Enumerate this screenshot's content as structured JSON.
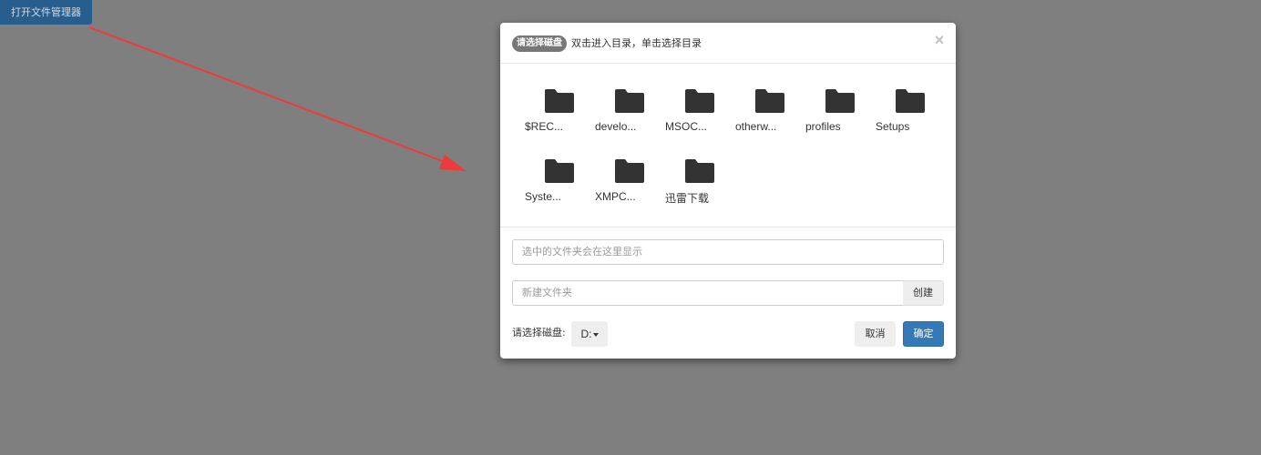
{
  "open_button": {
    "label": "打开文件管理器"
  },
  "modal": {
    "disk_badge": "请选择磁盘",
    "hint": "双击进入目录，单击选择目录",
    "close_symbol": "×",
    "folders": [
      {
        "label": "$REC...",
        "icon": "folder-icon"
      },
      {
        "label": "develo...",
        "icon": "folder-icon"
      },
      {
        "label": "MSOC...",
        "icon": "folder-icon"
      },
      {
        "label": "otherw...",
        "icon": "folder-icon"
      },
      {
        "label": "profiles",
        "icon": "folder-icon"
      },
      {
        "label": "Setups",
        "icon": "folder-icon"
      },
      {
        "label": "Syste...",
        "icon": "folder-icon"
      },
      {
        "label": "XMPC...",
        "icon": "folder-icon"
      },
      {
        "label": "迅雷下载",
        "icon": "folder-icon"
      }
    ],
    "selected_placeholder": "选中的文件夹会在这里显示",
    "new_folder_placeholder": "新建文件夹",
    "create_label": "创建",
    "disk_label": "请选择磁盘:",
    "disk_value": "D:",
    "cancel_label": "取消",
    "ok_label": "确定"
  },
  "colors": {
    "backdrop": "#7f7f7f",
    "open_button": "#285e8e",
    "primary": "#337ab7",
    "arrow": "#ee3a3a",
    "folder": "#333333"
  }
}
